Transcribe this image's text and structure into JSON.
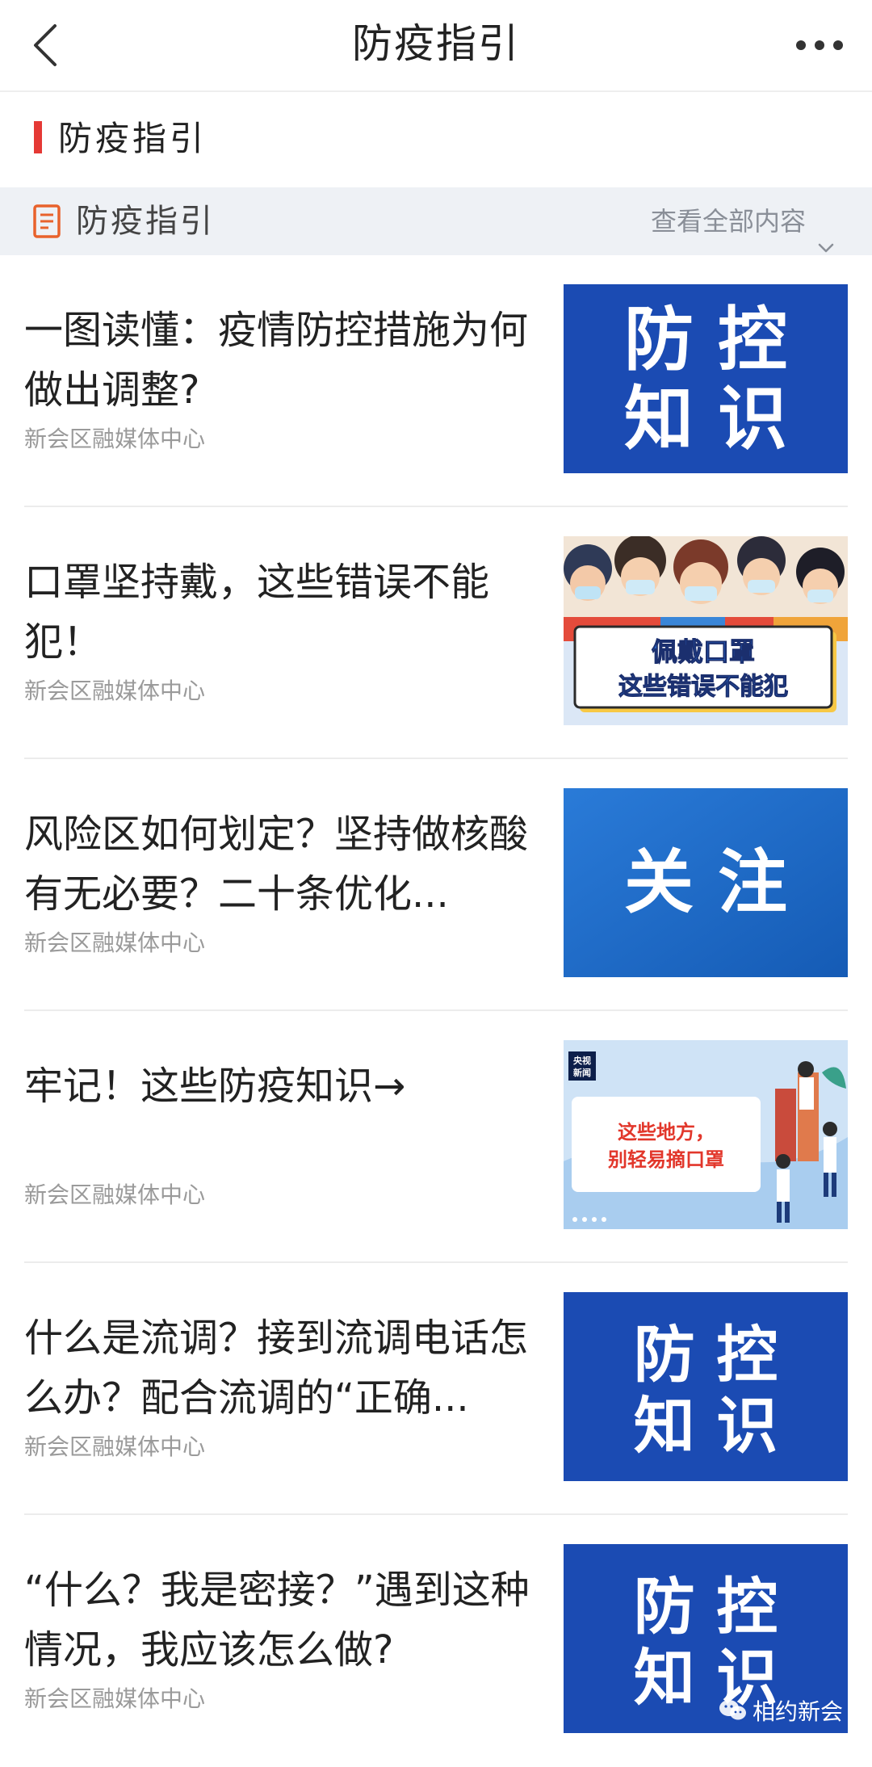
{
  "nav": {
    "title": "防疫指引"
  },
  "section": {
    "title": "防疫指引",
    "accent": "#e53935"
  },
  "sub_header": {
    "title": "防疫指引",
    "view_all": "查看全部内容"
  },
  "items": [
    {
      "title": "一图读懂：疫情防控措施为何做出调整?",
      "source": "新会区融媒体中心",
      "thumb": {
        "text": [
          "防 控",
          "知 识"
        ]
      }
    },
    {
      "title": "口罩坚持戴，这些错误不能犯！",
      "source": "新会区融媒体中心",
      "thumb": {
        "text": [
          "佩戴口罩",
          "这些错误不能犯"
        ]
      }
    },
    {
      "title": "风险区如何划定？坚持做核酸有无必要？二十条优化...",
      "source": "新会区融媒体中心",
      "thumb": {
        "text": [
          "关 注"
        ]
      }
    },
    {
      "title": "牢记！这些防疫知识→",
      "source": "新会区融媒体中心",
      "thumb": {
        "text": [
          "央视",
          "新闻",
          "这些地方，",
          "别轻易摘口罩"
        ]
      }
    },
    {
      "title": "什么是流调？接到流调电话怎么办？配合流调的“正确...",
      "source": "新会区融媒体中心",
      "thumb": {
        "text": [
          "防 控",
          "知 识"
        ]
      }
    },
    {
      "title": "“什么？我是密接？”遇到这种情况，我应该怎么做?",
      "source": "新会区融媒体中心",
      "thumb": {
        "text": [
          "防 控",
          "知 识"
        ]
      }
    }
  ],
  "watermark": {
    "text": "相约新会"
  }
}
